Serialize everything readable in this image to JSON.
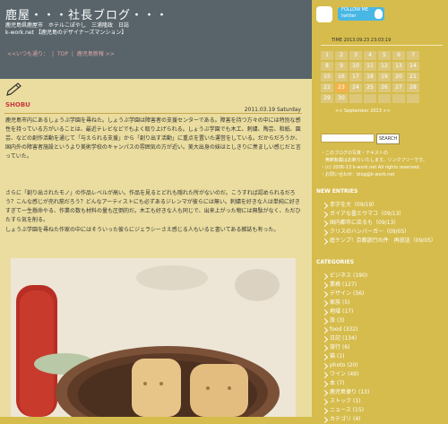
{
  "site": {
    "title": "鹿屋・・・社長ブログ・・・",
    "desc_line1": "鹿児島県鹿屋市　ホテルこぽやし　三浦隆政　日誌",
    "desc_line2": "k-work.net 【鹿児島のデザイナーズマンション】"
  },
  "nav": {
    "prev": "<<いつも通り：",
    "top": "TOP",
    "next": "鹿児島新報 >>"
  },
  "post": {
    "category": "SHOBU",
    "date": "2011.03.19 Saturday",
    "p1": "鹿児島市内にあるしょうぶ学園を尋ねた。しょうぶ学園は障害者の支援センターである。障害を持つ方々の中には特別な感性を持っている方がいることは、最近テレビなどでもよく取り上げられる。しょうぶ学園でも木工、刺繍、陶芸、和紙、園芸、などの創作活動を通じて「与えられる支援」から「創り出す活動」に重点を置いた運営をしている。だからだろうか、国内外の障害者施設というより美術学校のキャンパスの雰囲気の方が近い。美大出身の妹はとしきりに羨ましい感じだと言っていた。",
    "p2": "さらに「創り出されたモノ」の作品レベルが高い。作品を見るとどれも隠れた所がないのだ。こうすれば認められるだろう？こんな感じが売れ筋だろう？どんなアーティストにも必ずあるジレンマが彼らには無い。刺繍を好きな人は単純に好きすぎて一生懸命やる、作業の数も材料の量も圧倒的だ。木工も好きな人も同じで、出来上がった物には無駄がなく、ただひたすら気を削る。",
    "p3": "しょうぶ学園を尋ねた作家の中にはそういった彼らにジェラシーさえ感じる人もいると書いてある雑誌も有った。"
  },
  "sidebar": {
    "follow": "FOLLOW ME",
    "follow_sub": "twitter",
    "clock": "TIME 2013.09.23 23:03:19",
    "calendar": {
      "rows": [
        [
          "1",
          "2",
          "3",
          "4",
          "5",
          "6",
          "7"
        ],
        [
          "8",
          "9",
          "10",
          "11",
          "12",
          "13",
          "14"
        ],
        [
          "15",
          "16",
          "17",
          "18",
          "19",
          "20",
          "21"
        ],
        [
          "22",
          "23",
          "24",
          "25",
          "26",
          "27",
          "28"
        ],
        [
          "29",
          "30",
          "",
          "",
          "",
          "",
          ""
        ]
      ],
      "nav": "<< September 2013 >>"
    },
    "search_btn": "SEARCH",
    "notes": [
      "・このブログの写真・テキストの",
      "　無断転載はお断りいたします。リンクフリーです。",
      "・(c) 2006-13 k-work.net All rights reserved.",
      "・お問い合わせ：blog@k-work.net"
    ],
    "new_entries_title": "NEW ENTRIES",
    "new_entries": [
      "赤字を大（09/19）",
      "ガイアな曇とウマコ（09/13）",
      "国内都市に戻るも（09/13）",
      "クリスのハンバーガー（09/05）",
      "庭ケンプ！京都旅行の件　再放送（09/05）"
    ],
    "categories_title": "CATEGORIES",
    "categories": [
      {
        "name": "ビジネス",
        "count": "(190)"
      },
      {
        "name": "業務",
        "count": "(127)"
      },
      {
        "name": "デザイン",
        "count": "(56)"
      },
      {
        "name": "家族",
        "count": "(5)"
      },
      {
        "name": "地域",
        "count": "(17)"
      },
      {
        "name": "旅",
        "count": "(3)"
      },
      {
        "name": "food",
        "count": "(332)"
      },
      {
        "name": "日記",
        "count": "(134)"
      },
      {
        "name": "旅行",
        "count": "(6)"
      },
      {
        "name": "猫",
        "count": "(1)"
      },
      {
        "name": "photo",
        "count": "(20)"
      },
      {
        "name": "ワイン",
        "count": "(49)"
      },
      {
        "name": "本",
        "count": "(7)"
      },
      {
        "name": "鹿児島便り",
        "count": "(13)"
      },
      {
        "name": "ストック",
        "count": "(1)"
      },
      {
        "name": "ニュース",
        "count": "(15)"
      },
      {
        "name": "カテゴリ",
        "count": "(4)"
      }
    ]
  },
  "colors": {
    "header_bg": "#58646a",
    "main_bg": "#eadd9f",
    "sidebar_bg": "#d6bc4c",
    "accent_red": "#c83840"
  }
}
